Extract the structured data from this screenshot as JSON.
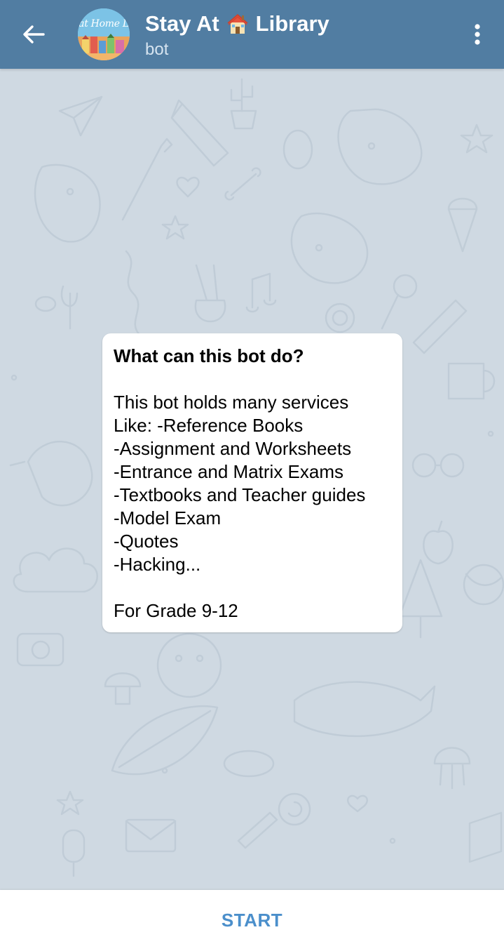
{
  "header": {
    "title_before_icon": "Stay At",
    "title_after_icon": "Library",
    "title_icon": "house-icon",
    "subtitle": "bot",
    "back_icon": "arrow-left-icon",
    "menu_icon": "more-vertical-icon",
    "avatar_text": "at Home L",
    "background_color": "#517da2"
  },
  "bot_info": {
    "title": "What can this bot do?",
    "lines": [
      "This bot holds many services",
      "Like: -Reference Books",
      "-Assignment and Worksheets",
      "-Entrance and Matrix Exams",
      "-Textbooks and Teacher guides",
      "-Model Exam",
      "-Quotes",
      "-Hacking..."
    ],
    "footer": "For Grade 9-12"
  },
  "bottom_bar": {
    "start_label": "START",
    "accent_color": "#4b8fcb"
  },
  "chat_background_color": "#cfd9e2"
}
